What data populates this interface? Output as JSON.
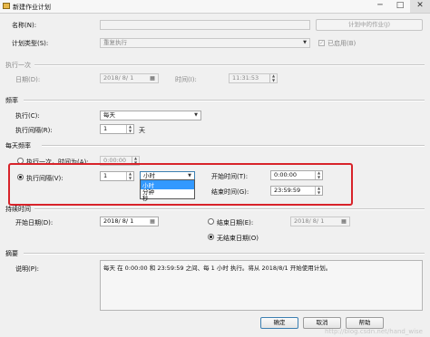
{
  "window": {
    "title": "新建作业计划",
    "minimize": "─",
    "maximize": "□",
    "close": "✕"
  },
  "name": {
    "label": "名称(N):",
    "value": "",
    "jobs_button": "计划中的作业(J)"
  },
  "schedule_type": {
    "label": "计划类型(S):",
    "value": "重复执行",
    "enabled_label": "已启用(B)",
    "enabled": true
  },
  "once": {
    "section": "执行一次",
    "date_label": "日期(D):",
    "date_value": "2018/ 8/ 1",
    "time_label": "时间(I):",
    "time_value": "11:31:53"
  },
  "frequency": {
    "section": "频率",
    "occurs_label": "执行(C):",
    "occurs_value": "每天",
    "recur_label": "执行间隔(R):",
    "recur_value": "1",
    "recur_unit": "天"
  },
  "daily": {
    "section": "每天频率",
    "once_at_label": "执行一次，时间为(A):",
    "once_at_value": "0:00:00",
    "every_label": "执行间隔(V):",
    "every_value": "1",
    "unit_value": "小时",
    "unit_options": [
      "小时",
      "分钟",
      "秒"
    ],
    "start_label": "开始时间(T):",
    "start_value": "0:00:00",
    "end_label": "结束时间(G):",
    "end_value": "23:59:59"
  },
  "duration": {
    "section": "持续时间",
    "start_date_label": "开始日期(D):",
    "start_date_value": "2018/ 8/ 1",
    "end_date_label": "结束日期(E):",
    "end_date_value": "2018/ 8/ 1",
    "no_end_label": "无结束日期(O)",
    "no_end_selected": true
  },
  "summary": {
    "section": "摘要",
    "desc_label": "说明(P):",
    "desc_value": "每天 在 0:00:00 和 23:59:59 之间、每 1 小时 执行。将从 2018/8/1 开始使用计划。"
  },
  "buttons": {
    "ok": "确定",
    "cancel": "取消",
    "help": "帮助"
  },
  "watermark": "http://blog.csdn.net/hand_wise",
  "icons": {
    "app": "calendar-app-icon",
    "dropdown": "chevron-down-icon",
    "spin": "spin-arrows-icon",
    "calendar": "calendar-icon"
  },
  "colors": {
    "highlight_box": "#d8232a",
    "selection": "#3399ff"
  }
}
